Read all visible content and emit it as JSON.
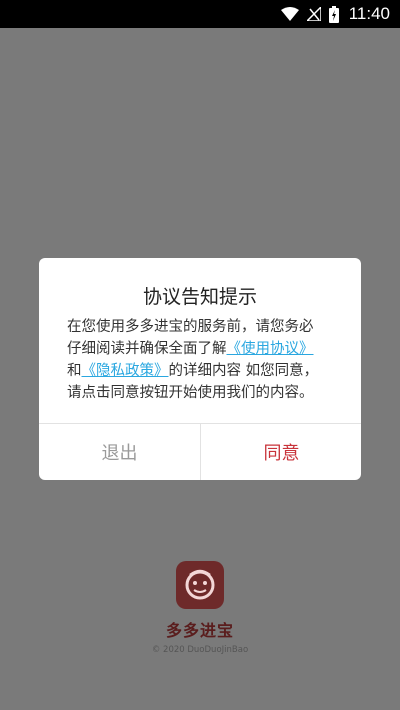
{
  "status_bar": {
    "time": "11:40",
    "icons": [
      "wifi-icon",
      "signal-icon",
      "battery-charging-icon"
    ]
  },
  "dialog": {
    "title": "协议告知提示",
    "body": {
      "line1": "在您使用多多进宝的服务前，请您务必",
      "line2_prefix": "仔细阅读并确保全面了解",
      "terms_link": "《使用协议》",
      "line3_prefix": "和",
      "privacy_link": "《隐私政策》",
      "line3_suffix": "的详细内容 如您同意，",
      "line4": "请点击同意按钮开始使用我们的内容。"
    },
    "buttons": {
      "exit": "退出",
      "agree": "同意"
    }
  },
  "app": {
    "name": "多多进宝",
    "copyright": "© 2020 DuoDuoJinBao"
  },
  "colors": {
    "overlay": "#7a7a7a",
    "link": "#2aa7e0",
    "agree": "#c8333a",
    "exit": "#9a9a9a",
    "logo_bg": "#6e2a2a"
  }
}
